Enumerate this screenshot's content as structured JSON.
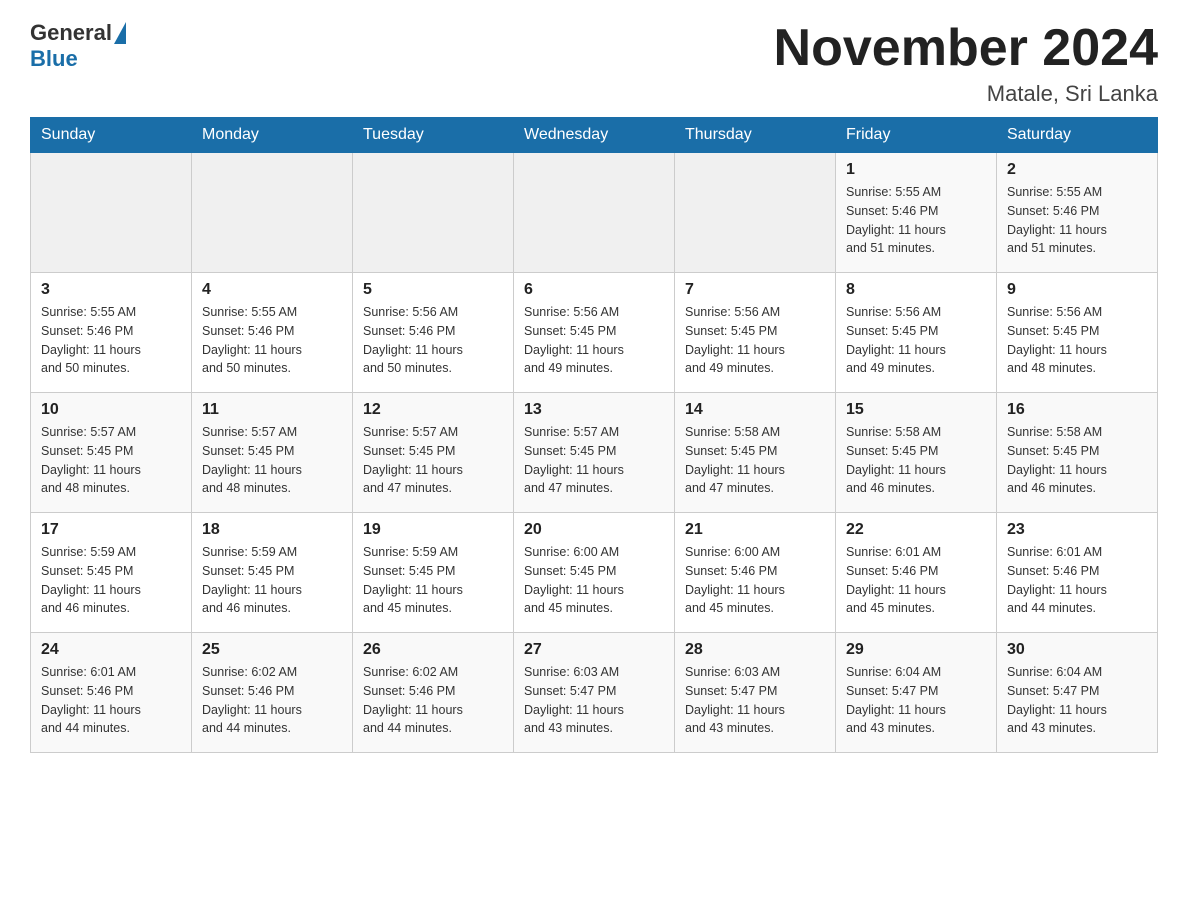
{
  "header": {
    "logo_general": "General",
    "logo_blue": "Blue",
    "month_title": "November 2024",
    "location": "Matale, Sri Lanka"
  },
  "weekdays": [
    "Sunday",
    "Monday",
    "Tuesday",
    "Wednesday",
    "Thursday",
    "Friday",
    "Saturday"
  ],
  "weeks": [
    [
      {
        "day": "",
        "info": ""
      },
      {
        "day": "",
        "info": ""
      },
      {
        "day": "",
        "info": ""
      },
      {
        "day": "",
        "info": ""
      },
      {
        "day": "",
        "info": ""
      },
      {
        "day": "1",
        "info": "Sunrise: 5:55 AM\nSunset: 5:46 PM\nDaylight: 11 hours\nand 51 minutes."
      },
      {
        "day": "2",
        "info": "Sunrise: 5:55 AM\nSunset: 5:46 PM\nDaylight: 11 hours\nand 51 minutes."
      }
    ],
    [
      {
        "day": "3",
        "info": "Sunrise: 5:55 AM\nSunset: 5:46 PM\nDaylight: 11 hours\nand 50 minutes."
      },
      {
        "day": "4",
        "info": "Sunrise: 5:55 AM\nSunset: 5:46 PM\nDaylight: 11 hours\nand 50 minutes."
      },
      {
        "day": "5",
        "info": "Sunrise: 5:56 AM\nSunset: 5:46 PM\nDaylight: 11 hours\nand 50 minutes."
      },
      {
        "day": "6",
        "info": "Sunrise: 5:56 AM\nSunset: 5:45 PM\nDaylight: 11 hours\nand 49 minutes."
      },
      {
        "day": "7",
        "info": "Sunrise: 5:56 AM\nSunset: 5:45 PM\nDaylight: 11 hours\nand 49 minutes."
      },
      {
        "day": "8",
        "info": "Sunrise: 5:56 AM\nSunset: 5:45 PM\nDaylight: 11 hours\nand 49 minutes."
      },
      {
        "day": "9",
        "info": "Sunrise: 5:56 AM\nSunset: 5:45 PM\nDaylight: 11 hours\nand 48 minutes."
      }
    ],
    [
      {
        "day": "10",
        "info": "Sunrise: 5:57 AM\nSunset: 5:45 PM\nDaylight: 11 hours\nand 48 minutes."
      },
      {
        "day": "11",
        "info": "Sunrise: 5:57 AM\nSunset: 5:45 PM\nDaylight: 11 hours\nand 48 minutes."
      },
      {
        "day": "12",
        "info": "Sunrise: 5:57 AM\nSunset: 5:45 PM\nDaylight: 11 hours\nand 47 minutes."
      },
      {
        "day": "13",
        "info": "Sunrise: 5:57 AM\nSunset: 5:45 PM\nDaylight: 11 hours\nand 47 minutes."
      },
      {
        "day": "14",
        "info": "Sunrise: 5:58 AM\nSunset: 5:45 PM\nDaylight: 11 hours\nand 47 minutes."
      },
      {
        "day": "15",
        "info": "Sunrise: 5:58 AM\nSunset: 5:45 PM\nDaylight: 11 hours\nand 46 minutes."
      },
      {
        "day": "16",
        "info": "Sunrise: 5:58 AM\nSunset: 5:45 PM\nDaylight: 11 hours\nand 46 minutes."
      }
    ],
    [
      {
        "day": "17",
        "info": "Sunrise: 5:59 AM\nSunset: 5:45 PM\nDaylight: 11 hours\nand 46 minutes."
      },
      {
        "day": "18",
        "info": "Sunrise: 5:59 AM\nSunset: 5:45 PM\nDaylight: 11 hours\nand 46 minutes."
      },
      {
        "day": "19",
        "info": "Sunrise: 5:59 AM\nSunset: 5:45 PM\nDaylight: 11 hours\nand 45 minutes."
      },
      {
        "day": "20",
        "info": "Sunrise: 6:00 AM\nSunset: 5:45 PM\nDaylight: 11 hours\nand 45 minutes."
      },
      {
        "day": "21",
        "info": "Sunrise: 6:00 AM\nSunset: 5:46 PM\nDaylight: 11 hours\nand 45 minutes."
      },
      {
        "day": "22",
        "info": "Sunrise: 6:01 AM\nSunset: 5:46 PM\nDaylight: 11 hours\nand 45 minutes."
      },
      {
        "day": "23",
        "info": "Sunrise: 6:01 AM\nSunset: 5:46 PM\nDaylight: 11 hours\nand 44 minutes."
      }
    ],
    [
      {
        "day": "24",
        "info": "Sunrise: 6:01 AM\nSunset: 5:46 PM\nDaylight: 11 hours\nand 44 minutes."
      },
      {
        "day": "25",
        "info": "Sunrise: 6:02 AM\nSunset: 5:46 PM\nDaylight: 11 hours\nand 44 minutes."
      },
      {
        "day": "26",
        "info": "Sunrise: 6:02 AM\nSunset: 5:46 PM\nDaylight: 11 hours\nand 44 minutes."
      },
      {
        "day": "27",
        "info": "Sunrise: 6:03 AM\nSunset: 5:47 PM\nDaylight: 11 hours\nand 43 minutes."
      },
      {
        "day": "28",
        "info": "Sunrise: 6:03 AM\nSunset: 5:47 PM\nDaylight: 11 hours\nand 43 minutes."
      },
      {
        "day": "29",
        "info": "Sunrise: 6:04 AM\nSunset: 5:47 PM\nDaylight: 11 hours\nand 43 minutes."
      },
      {
        "day": "30",
        "info": "Sunrise: 6:04 AM\nSunset: 5:47 PM\nDaylight: 11 hours\nand 43 minutes."
      }
    ]
  ]
}
